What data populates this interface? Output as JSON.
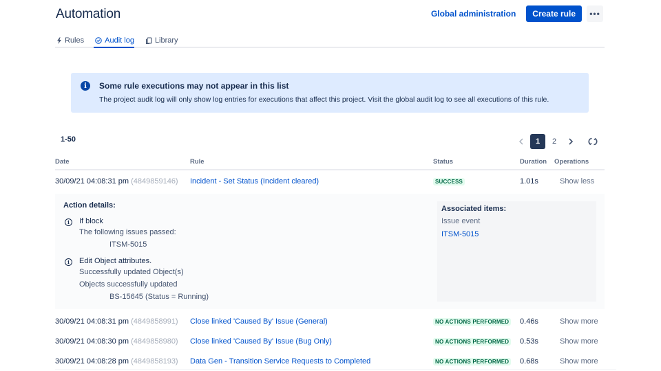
{
  "header": {
    "title": "Automation",
    "global_admin_label": "Global administration",
    "create_rule_label": "Create rule",
    "more_label": "•••"
  },
  "tabs": [
    {
      "label": "Rules",
      "icon": "lightning-icon",
      "active": false
    },
    {
      "label": "Audit log",
      "icon": "check-circle-icon",
      "active": true
    },
    {
      "label": "Library",
      "icon": "copy-icon",
      "active": false
    }
  ],
  "banner": {
    "icon": "info-icon",
    "title": "Some rule executions may not appear in this list",
    "text": "The project audit log will only show log entries for executions that affect this project. Visit the global audit log to see all executions of this rule."
  },
  "range_label": "1-50",
  "pagination": {
    "prev": "‹",
    "pages": [
      "1",
      "2"
    ],
    "current": "1",
    "next": "›"
  },
  "table": {
    "columns": [
      "Date",
      "Rule",
      "Status",
      "Duration",
      "Operations"
    ],
    "rows": [
      {
        "date": "30/09/21 04:08:31 pm",
        "id": "(4849859146)",
        "rule": "Incident - Set Status (Incident cleared)",
        "status": "SUCCESS",
        "duration": "1.01s",
        "operation": "Show less"
      },
      {
        "date": "30/09/21 04:08:31 pm",
        "id": "(4849858991)",
        "rule": "Close linked 'Caused By' Issue (General)",
        "status": "NO ACTIONS PERFORMED",
        "duration": "0.46s",
        "operation": "Show more"
      },
      {
        "date": "30/09/21 04:08:30 pm",
        "id": "(4849858980)",
        "rule": "Close linked 'Caused By' Issue (Bug Only)",
        "status": "NO ACTIONS PERFORMED",
        "duration": "0.53s",
        "operation": "Show more"
      },
      {
        "date": "30/09/21 04:08:28 pm",
        "id": "(4849858193)",
        "rule": "Data Gen - Transition Service Requests to Completed",
        "status": "NO ACTIONS PERFORMED",
        "duration": "0.68s",
        "operation": "Show more"
      }
    ]
  },
  "details": {
    "title": "Action details:",
    "actions": [
      {
        "title": "If block",
        "lines": [
          "The following issues passed:"
        ],
        "indented": [
          "ITSM-5015"
        ]
      },
      {
        "title": "Edit Object attributes.",
        "lines": [
          "Successfully updated Object(s)",
          "Objects successfully updated"
        ],
        "indented": [
          "BS-15645 (Status = Running)"
        ]
      }
    ],
    "associated": {
      "title": "Associated items:",
      "subtitle": "Issue event",
      "link": "ITSM-5015"
    }
  },
  "colors": {
    "brand": "#0052cc",
    "banner_bg": "#deebff",
    "success_bg": "#e3fcef",
    "success_text": "#006644",
    "current_page_bg": "#253858"
  }
}
